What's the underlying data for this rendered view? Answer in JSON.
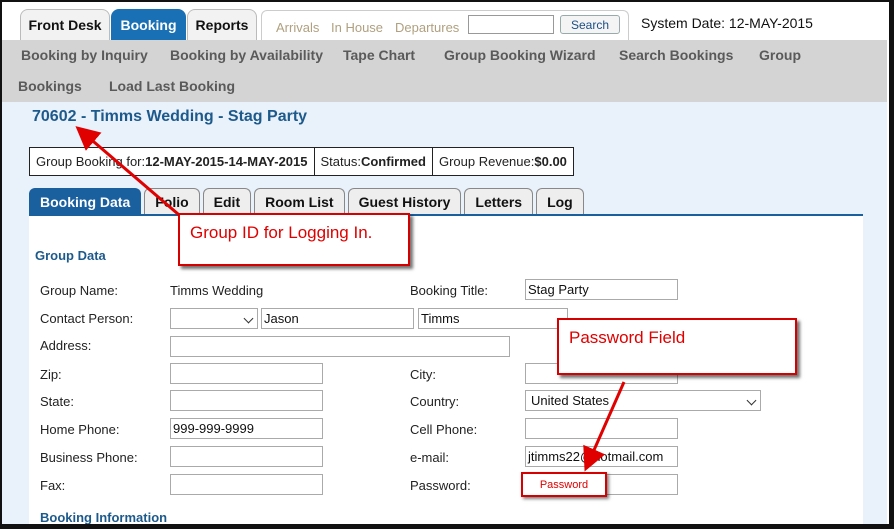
{
  "top_tabs": [
    {
      "label": "Front Desk",
      "active": false
    },
    {
      "label": "Booking",
      "active": true
    },
    {
      "label": "Reports",
      "active": false
    }
  ],
  "quick_links": [
    "Arrivals",
    "In House",
    "Departures"
  ],
  "search": {
    "button_label": "Search",
    "value": ""
  },
  "system_date": "System Date: 12-MAY-2015",
  "nav": {
    "row1": [
      "Booking by Inquiry",
      "Booking by Availability",
      "Tape Chart",
      "Group Booking Wizard",
      "Search Bookings",
      "Group"
    ],
    "row2": [
      "Bookings",
      "Load Last Booking"
    ]
  },
  "page_title": "70602 - Timms Wedding - Stag Party",
  "info": {
    "group_booking_label": "Group Booking for:",
    "group_booking_value": "12-MAY-2015-14-MAY-2015",
    "status_label": "Status:",
    "status_value": "Confirmed",
    "revenue_label": "Group Revenue:",
    "revenue_value": "$0.00"
  },
  "tabs": [
    {
      "label": "Booking Data",
      "active": true
    },
    {
      "label": "Folio",
      "active": false
    },
    {
      "label": "Edit",
      "active": false
    },
    {
      "label": "Room List",
      "active": false
    },
    {
      "label": "Guest History",
      "active": false
    },
    {
      "label": "Letters",
      "active": false
    },
    {
      "label": "Log",
      "active": false
    }
  ],
  "group_data": {
    "section_title": "Group Data",
    "group_name_label": "Group Name:",
    "group_name_value": "Timms Wedding",
    "booking_title_label": "Booking Title:",
    "booking_title_value": "Stag Party",
    "contact_person_label": "Contact Person:",
    "contact_salutation": "",
    "contact_first": "Jason",
    "contact_last": "Timms",
    "address_label": "Address:",
    "address_value": "",
    "zip_label": "Zip:",
    "zip_value": "",
    "city_label": "City:",
    "city_value": "",
    "state_label": "State:",
    "state_value": "",
    "country_label": "Country:",
    "country_value": "United States",
    "home_phone_label": "Home Phone:",
    "home_phone_value": "999-999-9999",
    "cell_phone_label": "Cell Phone:",
    "cell_phone_value": "",
    "business_phone_label": "Business Phone:",
    "business_phone_value": "",
    "email_label": "e-mail:",
    "email_value": "jtimms22@hotmail.com",
    "fax_label": "Fax:",
    "fax_value": "",
    "password_label": "Password:",
    "password_value": ""
  },
  "booking_info": {
    "section_title": "Booking Information"
  },
  "annotations": {
    "group_id_callout": "Group ID  for Logging In.",
    "password_callout": "Password Field",
    "password_badge": "Password",
    "color": "#e00000"
  },
  "colors": {
    "active_tab": "#1a70b5",
    "title_blue": "#1d5a8c",
    "nav_gray": "#d4d4d4",
    "content_bg": "#e9f1fb"
  }
}
